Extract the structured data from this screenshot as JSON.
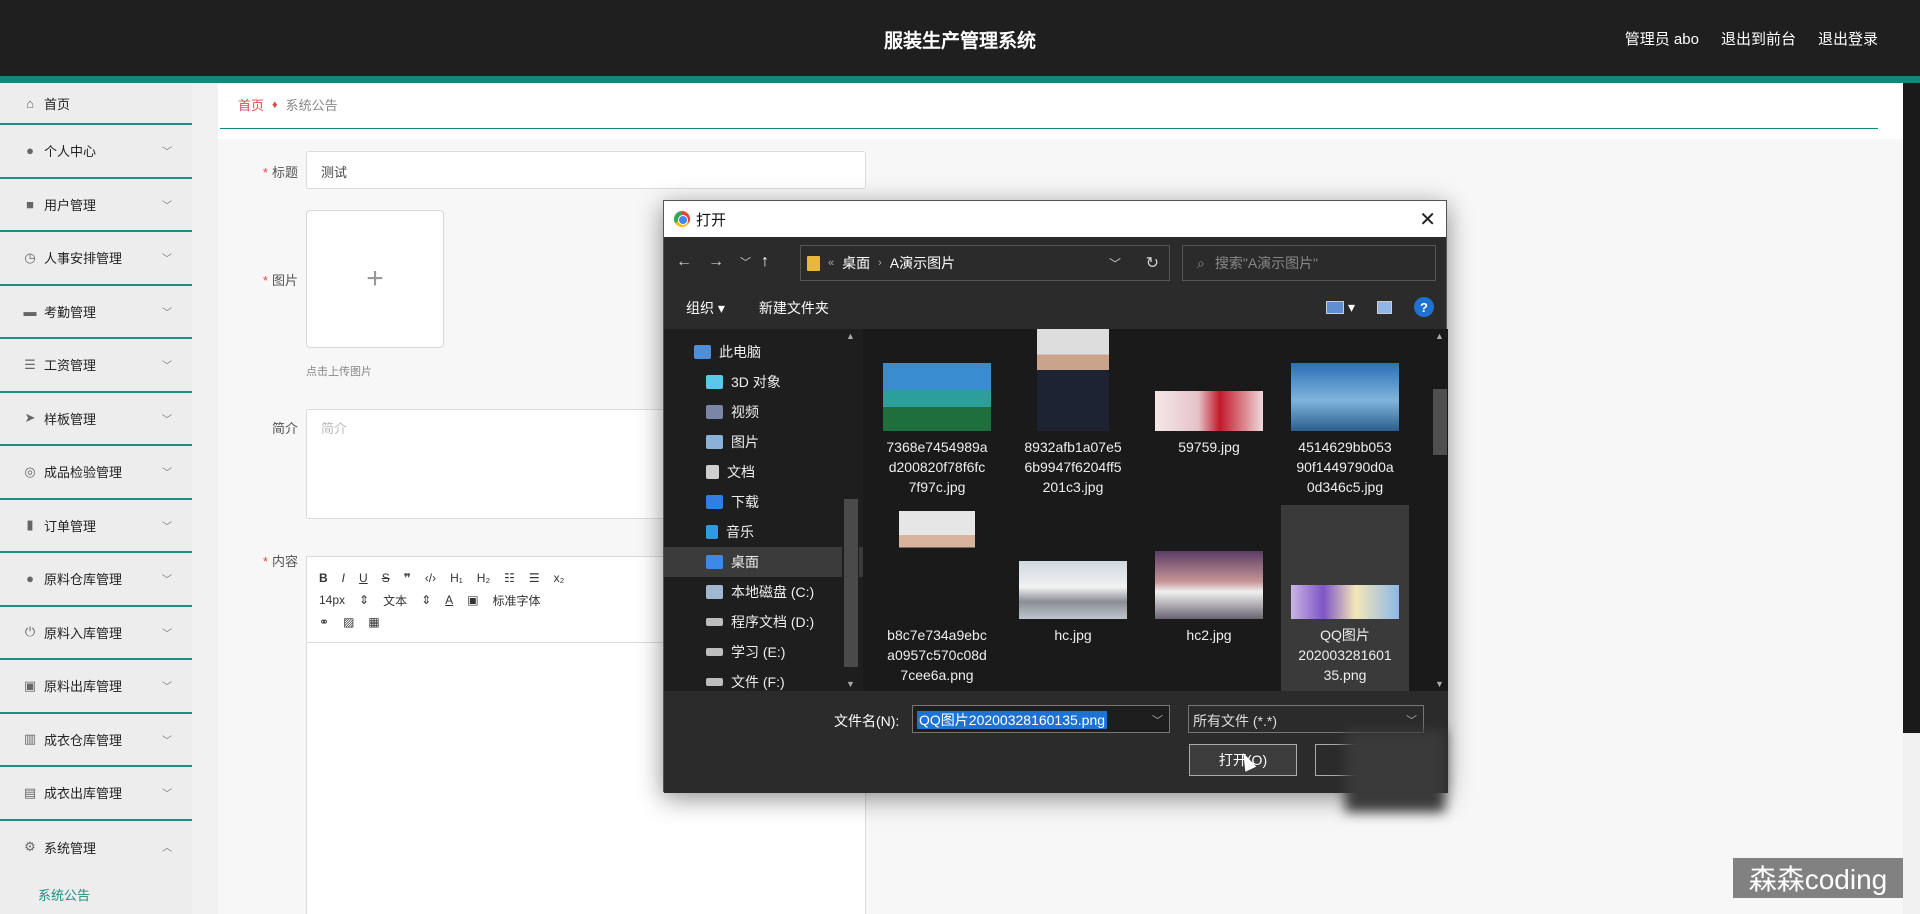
{
  "header": {
    "title": "服装生产管理系统",
    "user": "管理员 abo",
    "front_link": "退出到前台",
    "logout": "退出登录"
  },
  "sidebar": {
    "items": [
      {
        "label": "首页",
        "icon": "home-icon"
      },
      {
        "label": "个人中心",
        "icon": "user-icon"
      },
      {
        "label": "用户管理",
        "icon": "users-icon"
      },
      {
        "label": "人事安排管理",
        "icon": "clock-icon"
      },
      {
        "label": "考勤管理",
        "icon": "chat-icon"
      },
      {
        "label": "工资管理",
        "icon": "list-icon"
      },
      {
        "label": "样板管理",
        "icon": "send-icon"
      },
      {
        "label": "成品检验管理",
        "icon": "check-icon"
      },
      {
        "label": "订单管理",
        "icon": "order-icon"
      },
      {
        "label": "原料仓库管理",
        "icon": "person-icon"
      },
      {
        "label": "原料入库管理",
        "icon": "power-icon"
      },
      {
        "label": "原料出库管理",
        "icon": "box-icon"
      },
      {
        "label": "成衣仓库管理",
        "icon": "chart-icon"
      },
      {
        "label": "成衣出库管理",
        "icon": "clipboard-icon"
      },
      {
        "label": "系统管理",
        "icon": "gear-icon"
      }
    ],
    "sub_item": "系统公告"
  },
  "breadcrumb": {
    "home": "首页",
    "current": "系统公告"
  },
  "form": {
    "title_label": "标题",
    "title_value": "测试",
    "image_label": "图片",
    "upload_hint": "点击上传图片",
    "intro_label": "简介",
    "intro_placeholder": "简介",
    "content_label": "内容",
    "font_size": "14px",
    "text_style": "文本",
    "font_family": "标准字体"
  },
  "dialog": {
    "title": "打开",
    "path": [
      "桌面",
      "A演示图片"
    ],
    "search_placeholder": "搜索\"A演示图片\"",
    "organize": "组织",
    "new_folder": "新建文件夹",
    "tree": [
      {
        "label": "此电脑",
        "color": "#4f8fd8"
      },
      {
        "label": "3D 对象",
        "color": "#5cc7e8"
      },
      {
        "label": "视频",
        "color": "#7a86a8"
      },
      {
        "label": "图片",
        "color": "#8ab1d8"
      },
      {
        "label": "文档",
        "color": "#cfcfcf"
      },
      {
        "label": "下载",
        "color": "#2f80e0"
      },
      {
        "label": "音乐",
        "color": "#2f9be0"
      },
      {
        "label": "桌面",
        "color": "#3b8be3"
      },
      {
        "label": "本地磁盘 (C:)",
        "color": "#9fb8d0"
      },
      {
        "label": "程序文档 (D:)",
        "color": "#bdbdbd"
      },
      {
        "label": "学习 (E:)",
        "color": "#bdbdbd"
      },
      {
        "label": "文件 (F:)",
        "color": "#bdbdbd"
      }
    ],
    "files": [
      {
        "name": "7368e7454989ad200820f78f6fc7f97c.jpg",
        "lines": [
          "7368e7454989a",
          "d200820f78f6fc",
          "7f97c.jpg"
        ],
        "thumb": "sea"
      },
      {
        "name": "8932afb1a07e56b9947f6204ff5201c3.jpg",
        "lines": [
          "8932afb1a07e5",
          "6b9947f6204ff5",
          "201c3.jpg"
        ],
        "thumb": "man"
      },
      {
        "name": "59759.jpg",
        "lines": [
          "59759.jpg"
        ],
        "thumb": "banner"
      },
      {
        "name": "4514629bb05390f1449790d0a0d346c5.jpg",
        "lines": [
          "4514629bb053",
          "90f1449790d0a",
          "0d346c5.jpg"
        ],
        "thumb": "sky"
      },
      {
        "name": "b8c7e734a9ebca0957c570c08d7cee6a.png",
        "lines": [
          "b8c7e734a9ebc",
          "a0957c570c08d",
          "7cee6a.png"
        ],
        "thumb": "woman"
      },
      {
        "name": "hc.jpg",
        "lines": [
          "hc.jpg"
        ],
        "thumb": "train"
      },
      {
        "name": "hc2.jpg",
        "lines": [
          "hc2.jpg"
        ],
        "thumb": "train2"
      },
      {
        "name": "QQ图片20200328160135.png",
        "lines": [
          "QQ图片",
          "202003281601",
          "35.png"
        ],
        "thumb": "art"
      }
    ],
    "filename_label": "文件名(N):",
    "filename_value": "QQ图片20200328160135.png",
    "filetype": "所有文件 (*.*)",
    "open_button": "打开(O)"
  },
  "watermark": "森森coding"
}
